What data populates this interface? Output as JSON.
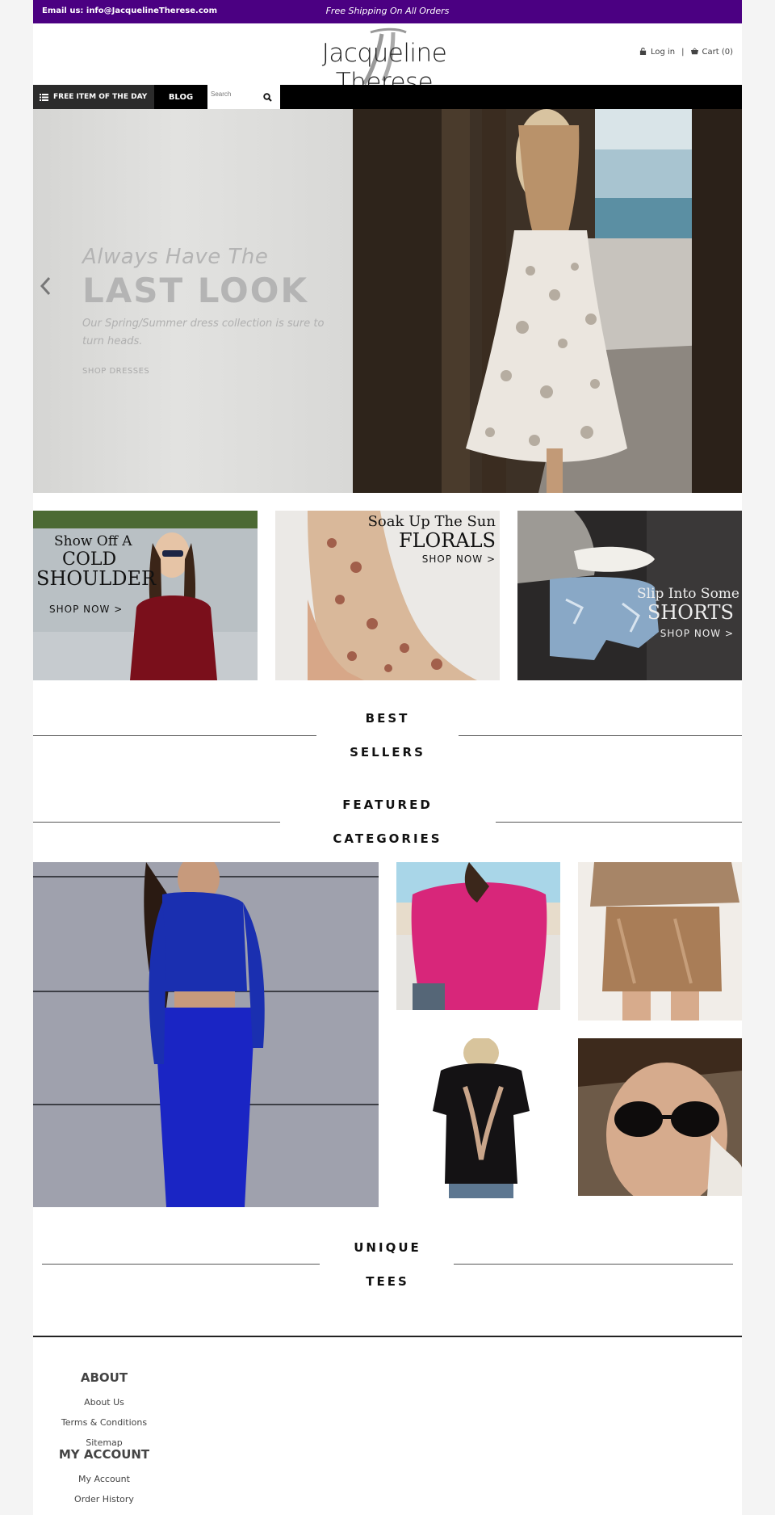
{
  "topbar": {
    "email_label": "Email us: info@JacquelineTherese.com",
    "shipping": "Free Shipping On All Orders",
    "background": "#4b0082"
  },
  "header": {
    "logo_text": "Jacqueline Therese",
    "login_label": "Log in",
    "separator": "|",
    "cart_label": "Cart (0)",
    "login_icon": "lock-icon",
    "cart_icon": "basket-icon"
  },
  "nav": {
    "free_item_label": "FREE ITEM OF THE DAY",
    "blog_label": "BLOG",
    "search_placeholder": "Search",
    "menu_icon": "list-icon",
    "search_icon": "search-icon"
  },
  "hero": {
    "subtitle": "Always Have The",
    "title": "LAST LOOK",
    "description": "Our Spring/Summer dress collection is sure to turn heads.",
    "cta": "SHOP DRESSES",
    "prev_icon": "chevron-left-icon"
  },
  "promos": [
    {
      "line1": "Show Off A",
      "line2": "COLD",
      "line3": "SHOULDER",
      "cta": "SHOP NOW >"
    },
    {
      "line1": "Soak Up The Sun",
      "line2": "FLORALS",
      "cta": "SHOP NOW >"
    },
    {
      "line1": "Slip Into Some",
      "line2": "SHORTS",
      "cta": "SHOP NOW >"
    }
  ],
  "sections": {
    "best_line1": "BEST",
    "best_line2": "SELLERS",
    "featured_line1": "FEATURED",
    "featured_line2": "CATEGORIES",
    "unique_line1": "UNIQUE",
    "unique_line2": "TEES"
  },
  "footer": {
    "about_heading": "ABOUT",
    "about_links": [
      "About Us",
      "Terms & Conditions",
      "Sitemap"
    ],
    "account_heading": "MY ACCOUNT",
    "account_links": [
      "My Account",
      "Order History"
    ]
  }
}
